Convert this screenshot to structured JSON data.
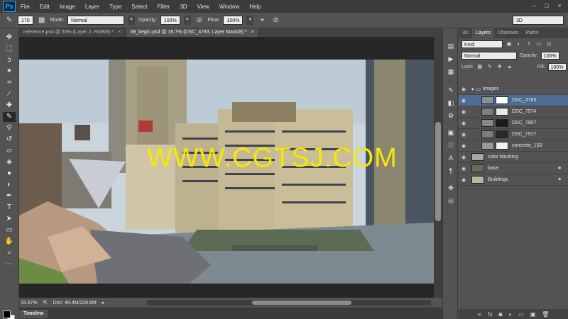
{
  "app": {
    "logo": "Ps"
  },
  "menu": [
    "File",
    "Edit",
    "Image",
    "Layer",
    "Type",
    "Select",
    "Filter",
    "3D",
    "View",
    "Window",
    "Help"
  ],
  "window_controls": [
    "–",
    "□",
    "×"
  ],
  "options": {
    "brush_size": "170",
    "mode_label": "Mode:",
    "mode_value": "Normal",
    "opacity_label": "Opacity:",
    "opacity_value": "100%",
    "flow_label": "Flow:",
    "flow_value": "100%",
    "workspace": "3D"
  },
  "tabs": [
    {
      "label": "reference.psd @ 50% (Layer 2, RGB/8) *",
      "close": "×"
    },
    {
      "label": "09_begin.psd @ 16.7% (DSC_4783, Layer Mask/8) *",
      "close": "×"
    }
  ],
  "watermark": "WWW.CGTSJ.COM",
  "status": {
    "zoom": "16.67%",
    "doc": "Doc: 49.4M/226.8M"
  },
  "timeline_label": "Timeline",
  "panel": {
    "tabs": [
      "3D",
      "Layers",
      "Channels",
      "Paths"
    ],
    "kind_label": "Kind",
    "blend_mode": "Normal",
    "opacity_label": "Opacity:",
    "opacity_value": "100%",
    "lock_label": "Lock:",
    "fill_label": "Fill:",
    "fill_value": "100%"
  },
  "layers": [
    {
      "name": "images",
      "type": "group"
    },
    {
      "name": "DSC_4783",
      "selected": true
    },
    {
      "name": "DSC_7974"
    },
    {
      "name": "DSC_7907"
    },
    {
      "name": "DSC_7917"
    },
    {
      "name": "concrete_153"
    },
    {
      "name": "color blocking"
    },
    {
      "name": "base",
      "locked": true
    },
    {
      "name": "Buildings",
      "locked": true
    }
  ],
  "colors": {
    "foreground": "#000000",
    "background": "#ffffff",
    "selection": "#4f6c93"
  }
}
